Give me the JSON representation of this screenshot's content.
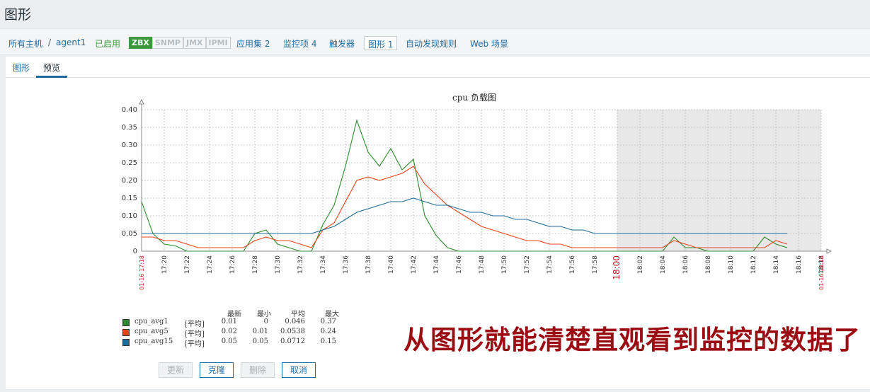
{
  "page": {
    "title": "图形"
  },
  "nav": {
    "all_hosts": "所有主机",
    "separator": "/",
    "host": "agent1",
    "status": "已启用",
    "badges": [
      "ZBX",
      "SNMP",
      "JMX",
      "IPMI"
    ],
    "applications": "应用集 2",
    "items": "监控项 4",
    "triggers": "触发器",
    "graphs": "图形 1",
    "discovery": "自动发现规则",
    "web": "Web 场景"
  },
  "tabs": {
    "graph": "图形",
    "preview": "预览"
  },
  "chart_data": {
    "type": "line",
    "title": "cpu 负载图",
    "ylim": [
      0,
      0.4
    ],
    "y_ticks": [
      "0",
      "0.05",
      "0.10",
      "0.15",
      "0.20",
      "0.25",
      "0.30",
      "0.35",
      "0.40"
    ],
    "x_ticks": [
      "17:20",
      "17:22",
      "17:24",
      "17:26",
      "17:28",
      "17:30",
      "17:32",
      "17:34",
      "17:36",
      "17:38",
      "17:40",
      "17:42",
      "17:44",
      "17:46",
      "17:48",
      "17:50",
      "17:52",
      "17:54",
      "17:56",
      "17:58",
      "18:00",
      "18:02",
      "18:04",
      "18:06",
      "18:08",
      "18:10",
      "18:12",
      "18:14",
      "18:16",
      "18:18"
    ],
    "x_start_label": "01-16 17:18",
    "x_end_label": "01-16 18:18",
    "highlight_tick": "18:00",
    "shaded_from_minute": 42,
    "x_minutes_range": [
      0,
      60
    ],
    "grid": true,
    "series": [
      {
        "name": "cpu_avg1",
        "color": "#2c8a2c",
        "func": "[平均]",
        "last": "0.01",
        "min": "0",
        "avg": "0.046",
        "max": "0.37",
        "points": [
          [
            0,
            0.14
          ],
          [
            1,
            0.05
          ],
          [
            2,
            0.02
          ],
          [
            3,
            0.015
          ],
          [
            4,
            0.0
          ],
          [
            9,
            0.0
          ],
          [
            10,
            0.05
          ],
          [
            11,
            0.06
          ],
          [
            12,
            0.02
          ],
          [
            13,
            0.01
          ],
          [
            14,
            0.0
          ],
          [
            15,
            0.0
          ],
          [
            16,
            0.075
          ],
          [
            17,
            0.13
          ],
          [
            18,
            0.24
          ],
          [
            19,
            0.37
          ],
          [
            20,
            0.28
          ],
          [
            21,
            0.24
          ],
          [
            22,
            0.29
          ],
          [
            23,
            0.23
          ],
          [
            24,
            0.26
          ],
          [
            25,
            0.1
          ],
          [
            26,
            0.045
          ],
          [
            27,
            0.01
          ],
          [
            28,
            0.0
          ],
          [
            40,
            0.0
          ],
          [
            46,
            0.0
          ],
          [
            47,
            0.04
          ],
          [
            48,
            0.01
          ],
          [
            49,
            0.01
          ],
          [
            50,
            0.0
          ],
          [
            54,
            0.0
          ],
          [
            55,
            0.04
          ],
          [
            56,
            0.02
          ],
          [
            57,
            0.01
          ]
        ]
      },
      {
        "name": "cpu_avg5",
        "color": "#e8431c",
        "func": "[平均]",
        "last": "0.02",
        "min": "0.01",
        "avg": "0.0538",
        "max": "0.24",
        "points": [
          [
            0,
            0.04
          ],
          [
            1,
            0.04
          ],
          [
            2,
            0.03
          ],
          [
            3,
            0.03
          ],
          [
            4,
            0.02
          ],
          [
            5,
            0.01
          ],
          [
            9,
            0.01
          ],
          [
            10,
            0.03
          ],
          [
            11,
            0.04
          ],
          [
            12,
            0.03
          ],
          [
            13,
            0.03
          ],
          [
            14,
            0.02
          ],
          [
            15,
            0.01
          ],
          [
            16,
            0.06
          ],
          [
            17,
            0.08
          ],
          [
            18,
            0.14
          ],
          [
            19,
            0.2
          ],
          [
            20,
            0.21
          ],
          [
            21,
            0.2
          ],
          [
            22,
            0.21
          ],
          [
            23,
            0.22
          ],
          [
            24,
            0.24
          ],
          [
            25,
            0.19
          ],
          [
            26,
            0.16
          ],
          [
            27,
            0.13
          ],
          [
            28,
            0.11
          ],
          [
            29,
            0.09
          ],
          [
            30,
            0.07
          ],
          [
            31,
            0.06
          ],
          [
            32,
            0.05
          ],
          [
            33,
            0.04
          ],
          [
            34,
            0.03
          ],
          [
            35,
            0.03
          ],
          [
            36,
            0.02
          ],
          [
            37,
            0.02
          ],
          [
            38,
            0.01
          ],
          [
            46,
            0.01
          ],
          [
            47,
            0.03
          ],
          [
            48,
            0.02
          ],
          [
            49,
            0.01
          ],
          [
            55,
            0.01
          ],
          [
            56,
            0.03
          ],
          [
            57,
            0.02
          ]
        ]
      },
      {
        "name": "cpu_avg15",
        "color": "#1e6b93",
        "func": "[平均]",
        "last": "0.05",
        "min": "0.05",
        "avg": "0.0712",
        "max": "0.15",
        "points": [
          [
            0,
            0.05
          ],
          [
            15,
            0.05
          ],
          [
            16,
            0.06
          ],
          [
            17,
            0.07
          ],
          [
            18,
            0.09
          ],
          [
            19,
            0.11
          ],
          [
            20,
            0.12
          ],
          [
            21,
            0.13
          ],
          [
            22,
            0.14
          ],
          [
            23,
            0.14
          ],
          [
            24,
            0.15
          ],
          [
            25,
            0.14
          ],
          [
            26,
            0.13
          ],
          [
            27,
            0.13
          ],
          [
            28,
            0.12
          ],
          [
            29,
            0.11
          ],
          [
            30,
            0.11
          ],
          [
            31,
            0.1
          ],
          [
            32,
            0.1
          ],
          [
            33,
            0.09
          ],
          [
            34,
            0.09
          ],
          [
            35,
            0.08
          ],
          [
            36,
            0.07
          ],
          [
            37,
            0.07
          ],
          [
            38,
            0.06
          ],
          [
            39,
            0.06
          ],
          [
            40,
            0.05
          ],
          [
            57,
            0.05
          ]
        ]
      }
    ]
  },
  "legend": {
    "headers": {
      "last": "最新",
      "min": "最小",
      "avg": "平均",
      "max": "最大"
    }
  },
  "buttons": {
    "update": "更新",
    "clone": "克隆",
    "delete": "删除",
    "cancel": "取消"
  },
  "overlay": {
    "text": "从图形就能清楚直观看到监控的数据了"
  }
}
